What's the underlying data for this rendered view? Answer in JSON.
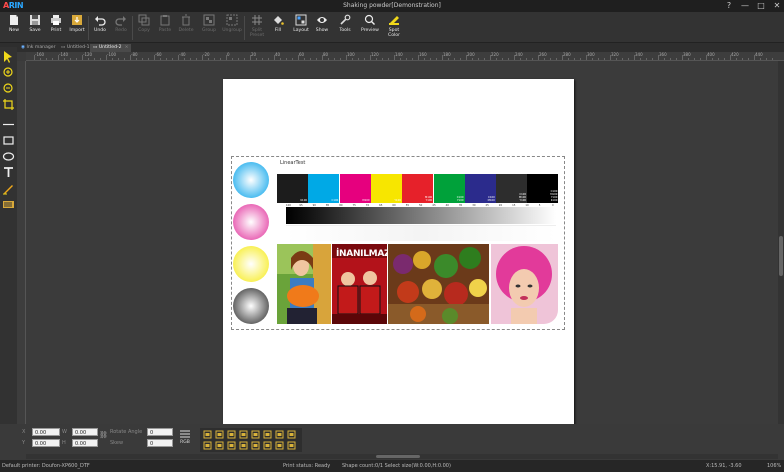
{
  "app": {
    "title": "Shaking powder[Demonstration]",
    "logo_a": "A",
    "logo_b": "RIN"
  },
  "window": {
    "help": "?",
    "minimize": "—",
    "maximize": "□",
    "close": "✕"
  },
  "toolbar": {
    "new": "New",
    "save": "Save",
    "print": "Print",
    "import": "Import",
    "undo": "Undo",
    "redo": "Redo",
    "copy": "Copy",
    "paste": "Paste",
    "delete": "Delete",
    "group": "Group",
    "ungroup": "Ungroup",
    "split_preset": "Split\nPreset",
    "fill": "Fill",
    "layout": "Layout",
    "show": "Show",
    "tools": "Tools",
    "preview": "Preview",
    "spot_color": "Spot\nColor"
  },
  "tabs": [
    {
      "label": "Ink manager"
    },
    {
      "label": "Untitled-1"
    },
    {
      "label": "Untitled-2"
    }
  ],
  "ruler": {
    "top": [
      "-160",
      "-140",
      "-120",
      "-100",
      "-80",
      "-60",
      "-40",
      "-20",
      "0",
      "20",
      "40",
      "60",
      "80",
      "100",
      "120",
      "140",
      "160",
      "180",
      "200",
      "220",
      "240",
      "260",
      "280",
      "300",
      "320",
      "340",
      "360",
      "380",
      "400",
      "420",
      "440"
    ]
  },
  "document": {
    "linear_title": "LinearTest",
    "swatch_colors": [
      "#1c1c1c",
      "#00a9e6",
      "#e6007e",
      "#f7e600",
      "#e6212a",
      "#00a13a",
      "#2b2b8c",
      "#2d2d2d",
      "#000000"
    ],
    "swatch_labels": [
      "K100",
      "C100",
      "M100",
      "Y100",
      "M100\nY100",
      "C100\nY100",
      "C100\nM100",
      "C100\nM100\nY100",
      "C100\nM100\nY100\nK100"
    ],
    "scale_ticks": [
      "100",
      "95",
      "90",
      "85",
      "80",
      "75",
      "70",
      "65",
      "60",
      "55",
      "50",
      "45",
      "40",
      "35",
      "30",
      "25",
      "20",
      "15",
      "10",
      "5",
      "0"
    ],
    "circle_colors": [
      "#3fb8ef",
      "#e85fb2",
      "#f8ef4a",
      "#5a5a5a"
    ]
  },
  "props": {
    "x_label": "X",
    "x_value": "0.00",
    "y_label": "Y",
    "y_value": "0.00",
    "w_label": "W",
    "w_value": "0.00",
    "h_label": "H",
    "h_value": "0.00",
    "rot_label": "Rotate Angle",
    "rot_value": "0",
    "shear_label": "Skew",
    "shear_value": "0",
    "rgb_label": "RGB"
  },
  "status": {
    "printer": "Default printer: Doufon-XP600_DTF",
    "print_status": "Print status: Ready",
    "shape_info": "Shape count:0/1   Select size(W:0.00,H:0.00)",
    "coords": "X:15.91, -3.60",
    "zoom": "106%"
  }
}
